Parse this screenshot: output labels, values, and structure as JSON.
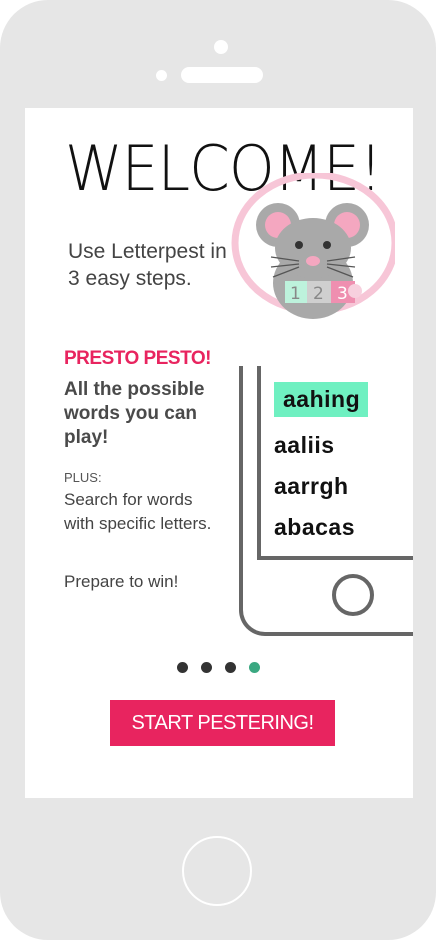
{
  "welcome": {
    "title": "WELCOME!",
    "intro": "Use Letterpest in 3 easy steps."
  },
  "illustration": {
    "steps": [
      "1",
      "2",
      "3"
    ],
    "colors": {
      "ring": "#f7c6d7",
      "mouse": "#a9a9a9",
      "ear_inner": "#f4a7c0",
      "step1": "#bdf2dc",
      "step2": "#cfcfcf",
      "step3": "#ef8fb0"
    }
  },
  "feature": {
    "title": "PRESTO PESTO!",
    "description": "All the possible words you can play!",
    "plus_label": "PLUS:",
    "plus_text": "Search for words with specific letters.",
    "closing": "Prepare to win!"
  },
  "word_list": [
    "aahing",
    "aaliis",
    "aarrgh",
    "abacas"
  ],
  "pagination": {
    "total": 4,
    "current": 4
  },
  "cta": {
    "label": "START PESTERING!"
  },
  "colors": {
    "accent": "#e8245f",
    "highlight": "#6ff0c1",
    "active_dot": "#3aa881"
  }
}
